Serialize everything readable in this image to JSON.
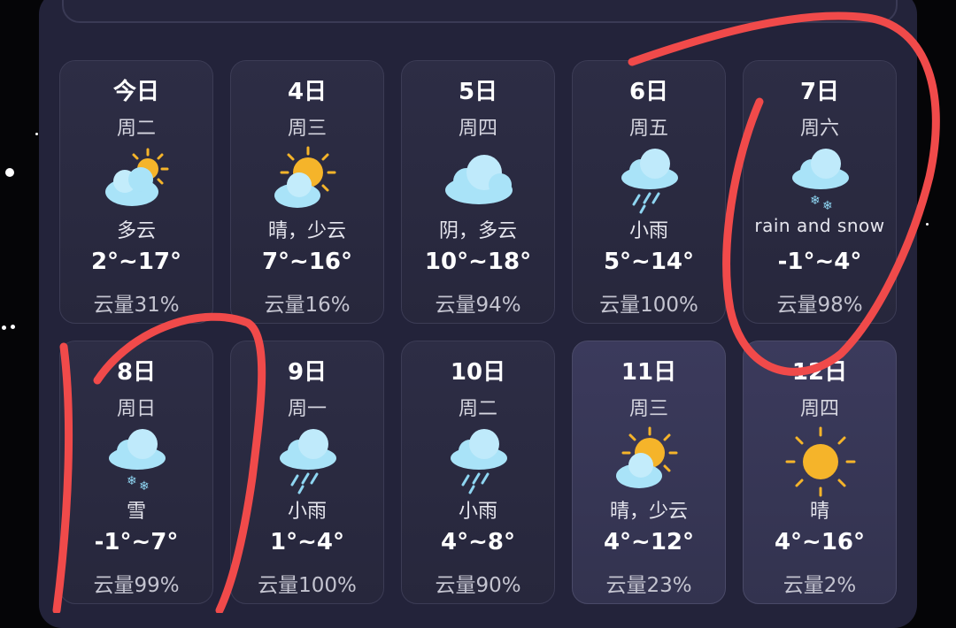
{
  "forecast": [
    {
      "date": "今日",
      "weekday": "周二",
      "icon": "cloudy-sun-icon",
      "condition": "多云",
      "temp": "2°~17°",
      "cloud": "云量31%"
    },
    {
      "date": "4日",
      "weekday": "周三",
      "icon": "sun-cloud-icon",
      "condition": "晴，少云",
      "temp": "7°~16°",
      "cloud": "云量16%"
    },
    {
      "date": "5日",
      "weekday": "周四",
      "icon": "cloud-icon",
      "condition": "阴，多云",
      "temp": "10°~18°",
      "cloud": "云量94%"
    },
    {
      "date": "6日",
      "weekday": "周五",
      "icon": "rain-cloud-icon",
      "condition": "小雨",
      "temp": "5°~14°",
      "cloud": "云量100%"
    },
    {
      "date": "7日",
      "weekday": "周六",
      "icon": "snow-cloud-icon",
      "condition": "rain and snow",
      "temp": "-1°~4°",
      "cloud": "云量98%"
    },
    {
      "date": "8日",
      "weekday": "周日",
      "icon": "snow-cloud-icon",
      "condition": "雪",
      "temp": "-1°~7°",
      "cloud": "云量99%"
    },
    {
      "date": "9日",
      "weekday": "周一",
      "icon": "rain-cloud-icon",
      "condition": "小雨",
      "temp": "1°~4°",
      "cloud": "云量100%"
    },
    {
      "date": "10日",
      "weekday": "周二",
      "icon": "rain-cloud-icon",
      "condition": "小雨",
      "temp": "4°~8°",
      "cloud": "云量90%"
    },
    {
      "date": "11日",
      "weekday": "周三",
      "icon": "sun-cloud-icon",
      "condition": "晴，少云",
      "temp": "4°~12°",
      "cloud": "云量23%"
    },
    {
      "date": "12日",
      "weekday": "周四",
      "icon": "sun-icon",
      "condition": "晴",
      "temp": "4°~16°",
      "cloud": "云量2%"
    }
  ],
  "colors": {
    "annotation": "#f04a4a",
    "cloud": "#a9e3f8",
    "sun": "#f5b42a"
  }
}
